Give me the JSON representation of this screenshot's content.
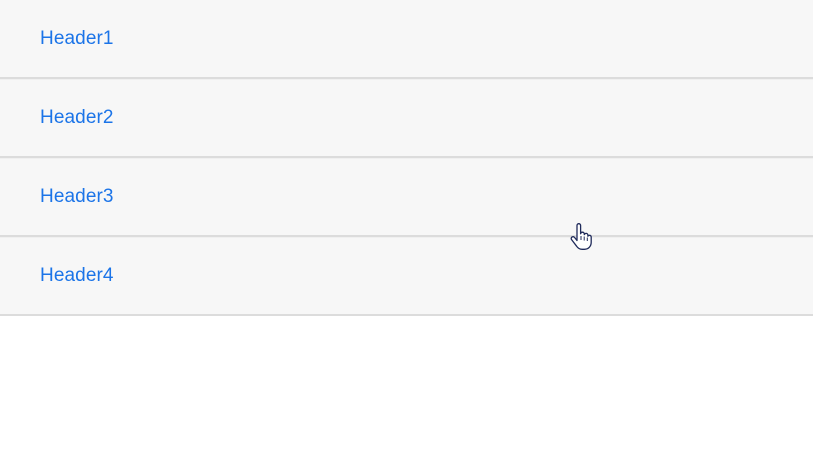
{
  "accordion": {
    "headers": [
      {
        "label": "Header1"
      },
      {
        "label": "Header2"
      },
      {
        "label": "Header3"
      },
      {
        "label": "Header4"
      }
    ]
  },
  "colors": {
    "header_text": "#1b74e8",
    "header_background": "#f7f7f7",
    "divider": "#dcdcdc"
  },
  "cursor": {
    "icon": "hand-pointer-icon"
  }
}
